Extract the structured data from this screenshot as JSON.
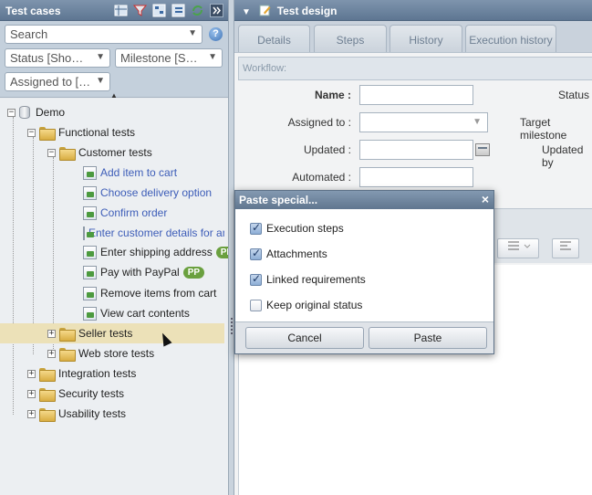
{
  "left_panel": {
    "title": "Test cases",
    "search_placeholder": "Search",
    "status_filter": "Status [Showing all]",
    "milestone_filter": "Milestone [Showing all]",
    "assigned_filter": "Assigned to [All]",
    "help": "?",
    "tree": {
      "root": "Demo",
      "functional": "Functional tests",
      "customer": "Customer tests",
      "items": [
        {
          "label": "Add item to cart",
          "link": true
        },
        {
          "label": "Choose delivery option",
          "link": true
        },
        {
          "label": "Confirm order",
          "link": true
        },
        {
          "label": "Enter customer details for an order",
          "link": true
        },
        {
          "label": "Enter shipping address",
          "link": false,
          "badge": "PP"
        },
        {
          "label": "Pay with PayPal",
          "link": false,
          "badge": "PP"
        },
        {
          "label": "Remove items from cart",
          "link": false
        },
        {
          "label": "View cart contents",
          "link": false
        }
      ],
      "seller": "Seller tests",
      "webstore": "Web store tests",
      "integration": "Integration tests",
      "security": "Security tests",
      "usability": "Usability tests"
    }
  },
  "right_panel": {
    "title": "Test design",
    "tabs": [
      "Details",
      "Steps",
      "History",
      "Execution history"
    ],
    "workflow_label": "Workflow:",
    "form": {
      "name_label": "Name :",
      "assigned_label": "Assigned to :",
      "updated_label": "Updated :",
      "automated_label": "Automated :",
      "status_label": "Status",
      "target_milestone_label": "Target milestone",
      "updated_by_label": "Updated by"
    }
  },
  "modal": {
    "title": "Paste special...",
    "close": "×",
    "options": [
      {
        "label": "Execution steps",
        "checked": true
      },
      {
        "label": "Attachments",
        "checked": true
      },
      {
        "label": "Linked requirements",
        "checked": true
      },
      {
        "label": "Keep original status",
        "checked": false
      }
    ],
    "cancel": "Cancel",
    "paste": "Paste"
  },
  "colors": {
    "header": "#6c839e",
    "link": "#3d5db8",
    "badge": "#6aa03f",
    "selection": "#ece1b8"
  }
}
